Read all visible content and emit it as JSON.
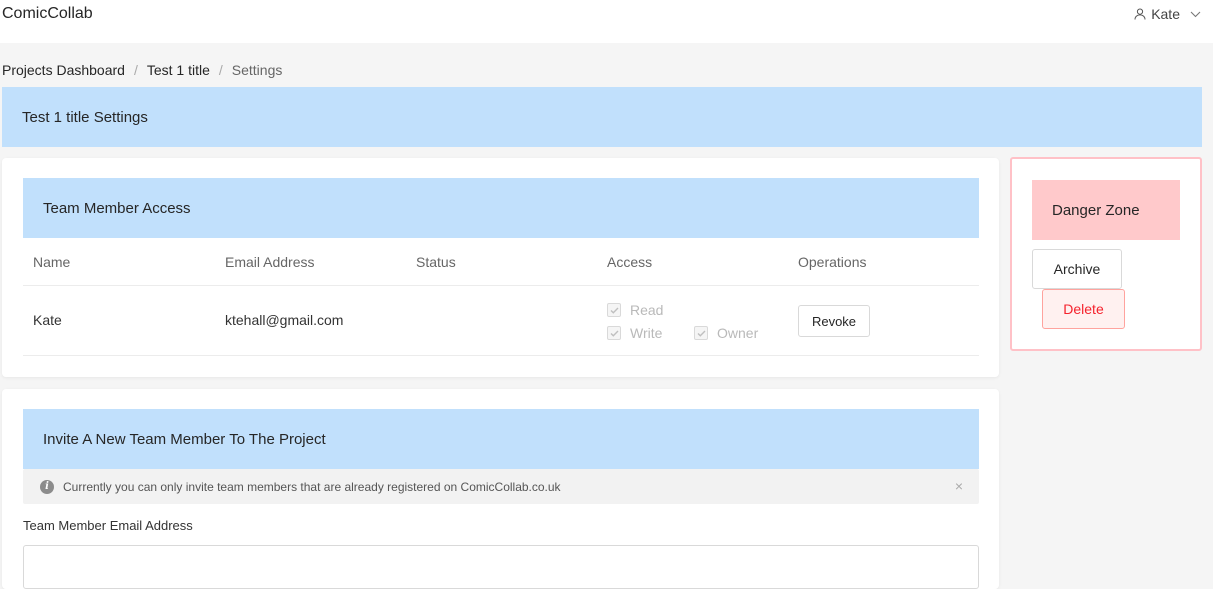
{
  "header": {
    "brand": "ComicCollab",
    "user_name": "Kate"
  },
  "breadcrumb": {
    "items": [
      "Projects Dashboard",
      "Test 1 title",
      "Settings"
    ],
    "separator": "/"
  },
  "page": {
    "title": "Test 1 title Settings"
  },
  "access": {
    "title": "Team Member Access",
    "columns": [
      "Name",
      "Email Address",
      "Status",
      "Access",
      "Operations"
    ],
    "row": {
      "name": "Kate",
      "email": "ktehall@gmail.com",
      "status": "",
      "permissions": {
        "read": "Read",
        "write": "Write",
        "owner": "Owner"
      },
      "revoke_label": "Revoke"
    }
  },
  "danger": {
    "title": "Danger Zone",
    "archive_label": "Archive",
    "delete_label": "Delete"
  },
  "invite": {
    "title": "Invite A New Team Member To The Project",
    "notice": "Currently you can only invite team members that are already registered on ComicCollab.co.uk",
    "close_icon": "×",
    "email_label": "Team Member Email Address",
    "email_value": ""
  },
  "colors": {
    "header_blue": "#c1e0fc",
    "danger_pink": "#ffc9cb",
    "danger_red": "#f5222d"
  }
}
